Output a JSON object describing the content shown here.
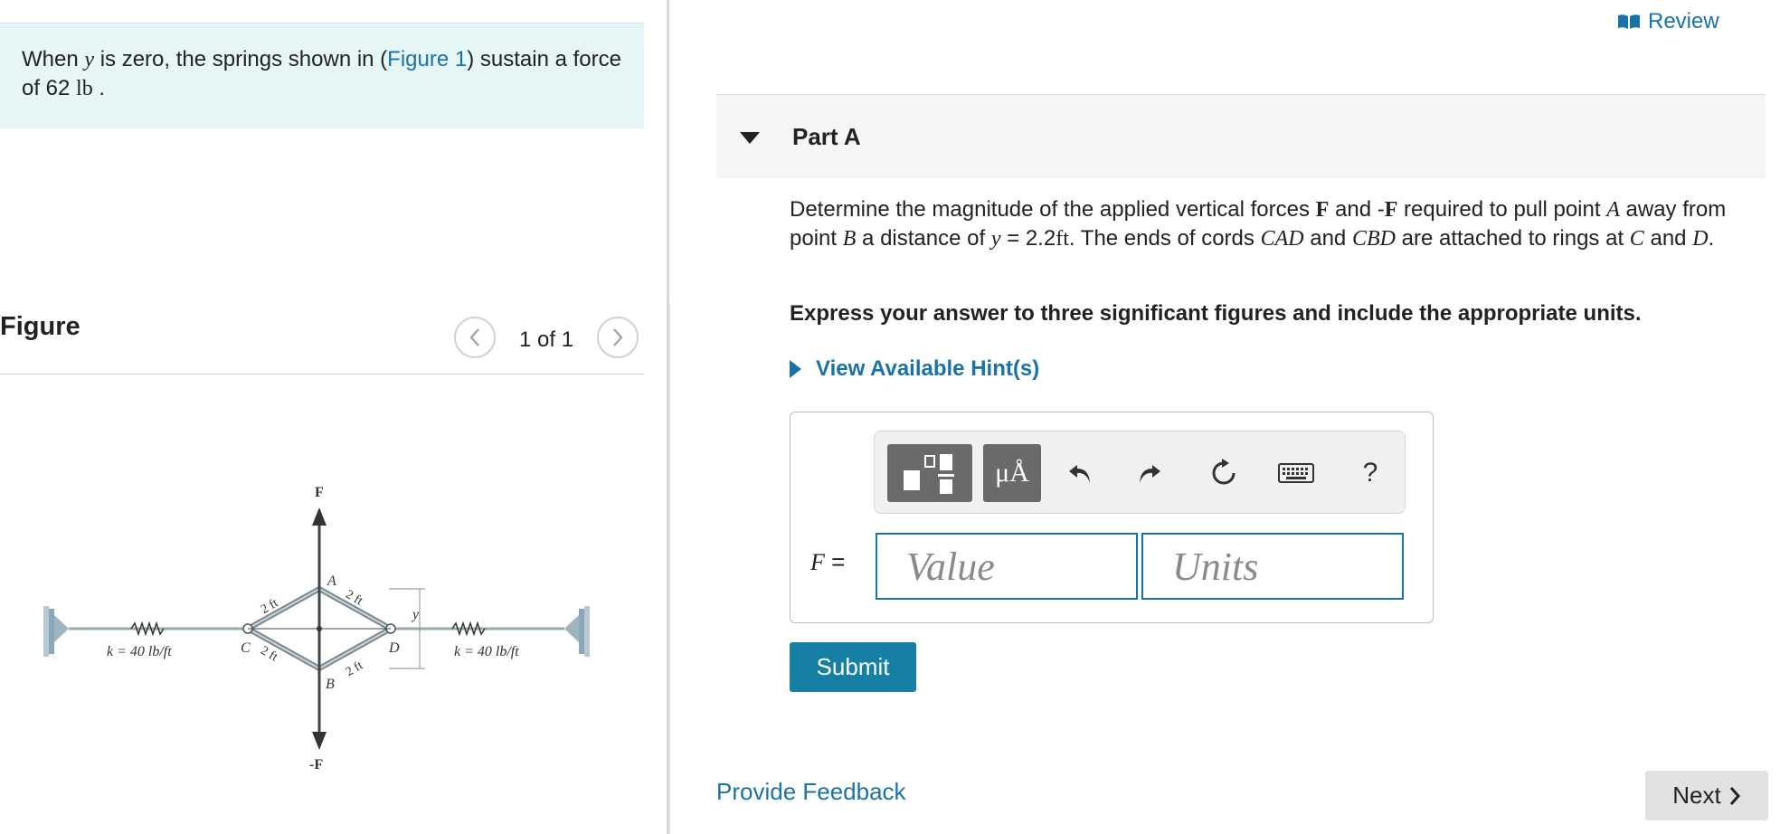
{
  "problem": {
    "text_1": "When ",
    "var_y": "y",
    "text_2": " is zero, the springs shown in (",
    "figure_link": "Figure 1",
    "text_3": ") sustain a force of 62 ",
    "unit": "lb",
    "text_4": " ."
  },
  "figure_panel": {
    "title": "Figure",
    "counter": "1 of 1",
    "labels": {
      "F_top": "F",
      "F_bottom": "-F",
      "A": "A",
      "B": "B",
      "C": "C",
      "D": "D",
      "y": "y",
      "len_ca": "2 ft",
      "len_ad": "2 ft",
      "len_cb": "2 ft",
      "len_bd": "2 ft",
      "k_left": "k = 40 lb/ft",
      "k_right": "k = 40 lb/ft"
    }
  },
  "header": {
    "review_label": "Review"
  },
  "part": {
    "title": "Part A"
  },
  "question": {
    "t1": "Determine the magnitude of the applied vertical forces ",
    "F": "F",
    "t2": " and -",
    "F2": "F",
    "t3": " required to pull point ",
    "A": "A",
    "t4": " away from point ",
    "B": "B",
    "t5": " a distance of ",
    "y": "y",
    "t6": " = 2.2",
    "ft": "ft",
    "t7": ". The ends of cords ",
    "CAD": "CAD",
    "t8": " and ",
    "CBD": "CBD",
    "t9": " are attached to rings at ",
    "C": "C",
    "t10": " and ",
    "D": "D",
    "t11": "."
  },
  "instruction": "Express your answer to three significant figures and include the appropriate units.",
  "hints_label": "View Available Hint(s)",
  "toolbar": {
    "units_label": "μÅ",
    "help_label": "?"
  },
  "answer": {
    "variable_label": "F",
    "equals": " =",
    "value_placeholder": "Value",
    "units_placeholder": "Units"
  },
  "submit_label": "Submit",
  "feedback_label": "Provide Feedback",
  "next_label": "Next"
}
